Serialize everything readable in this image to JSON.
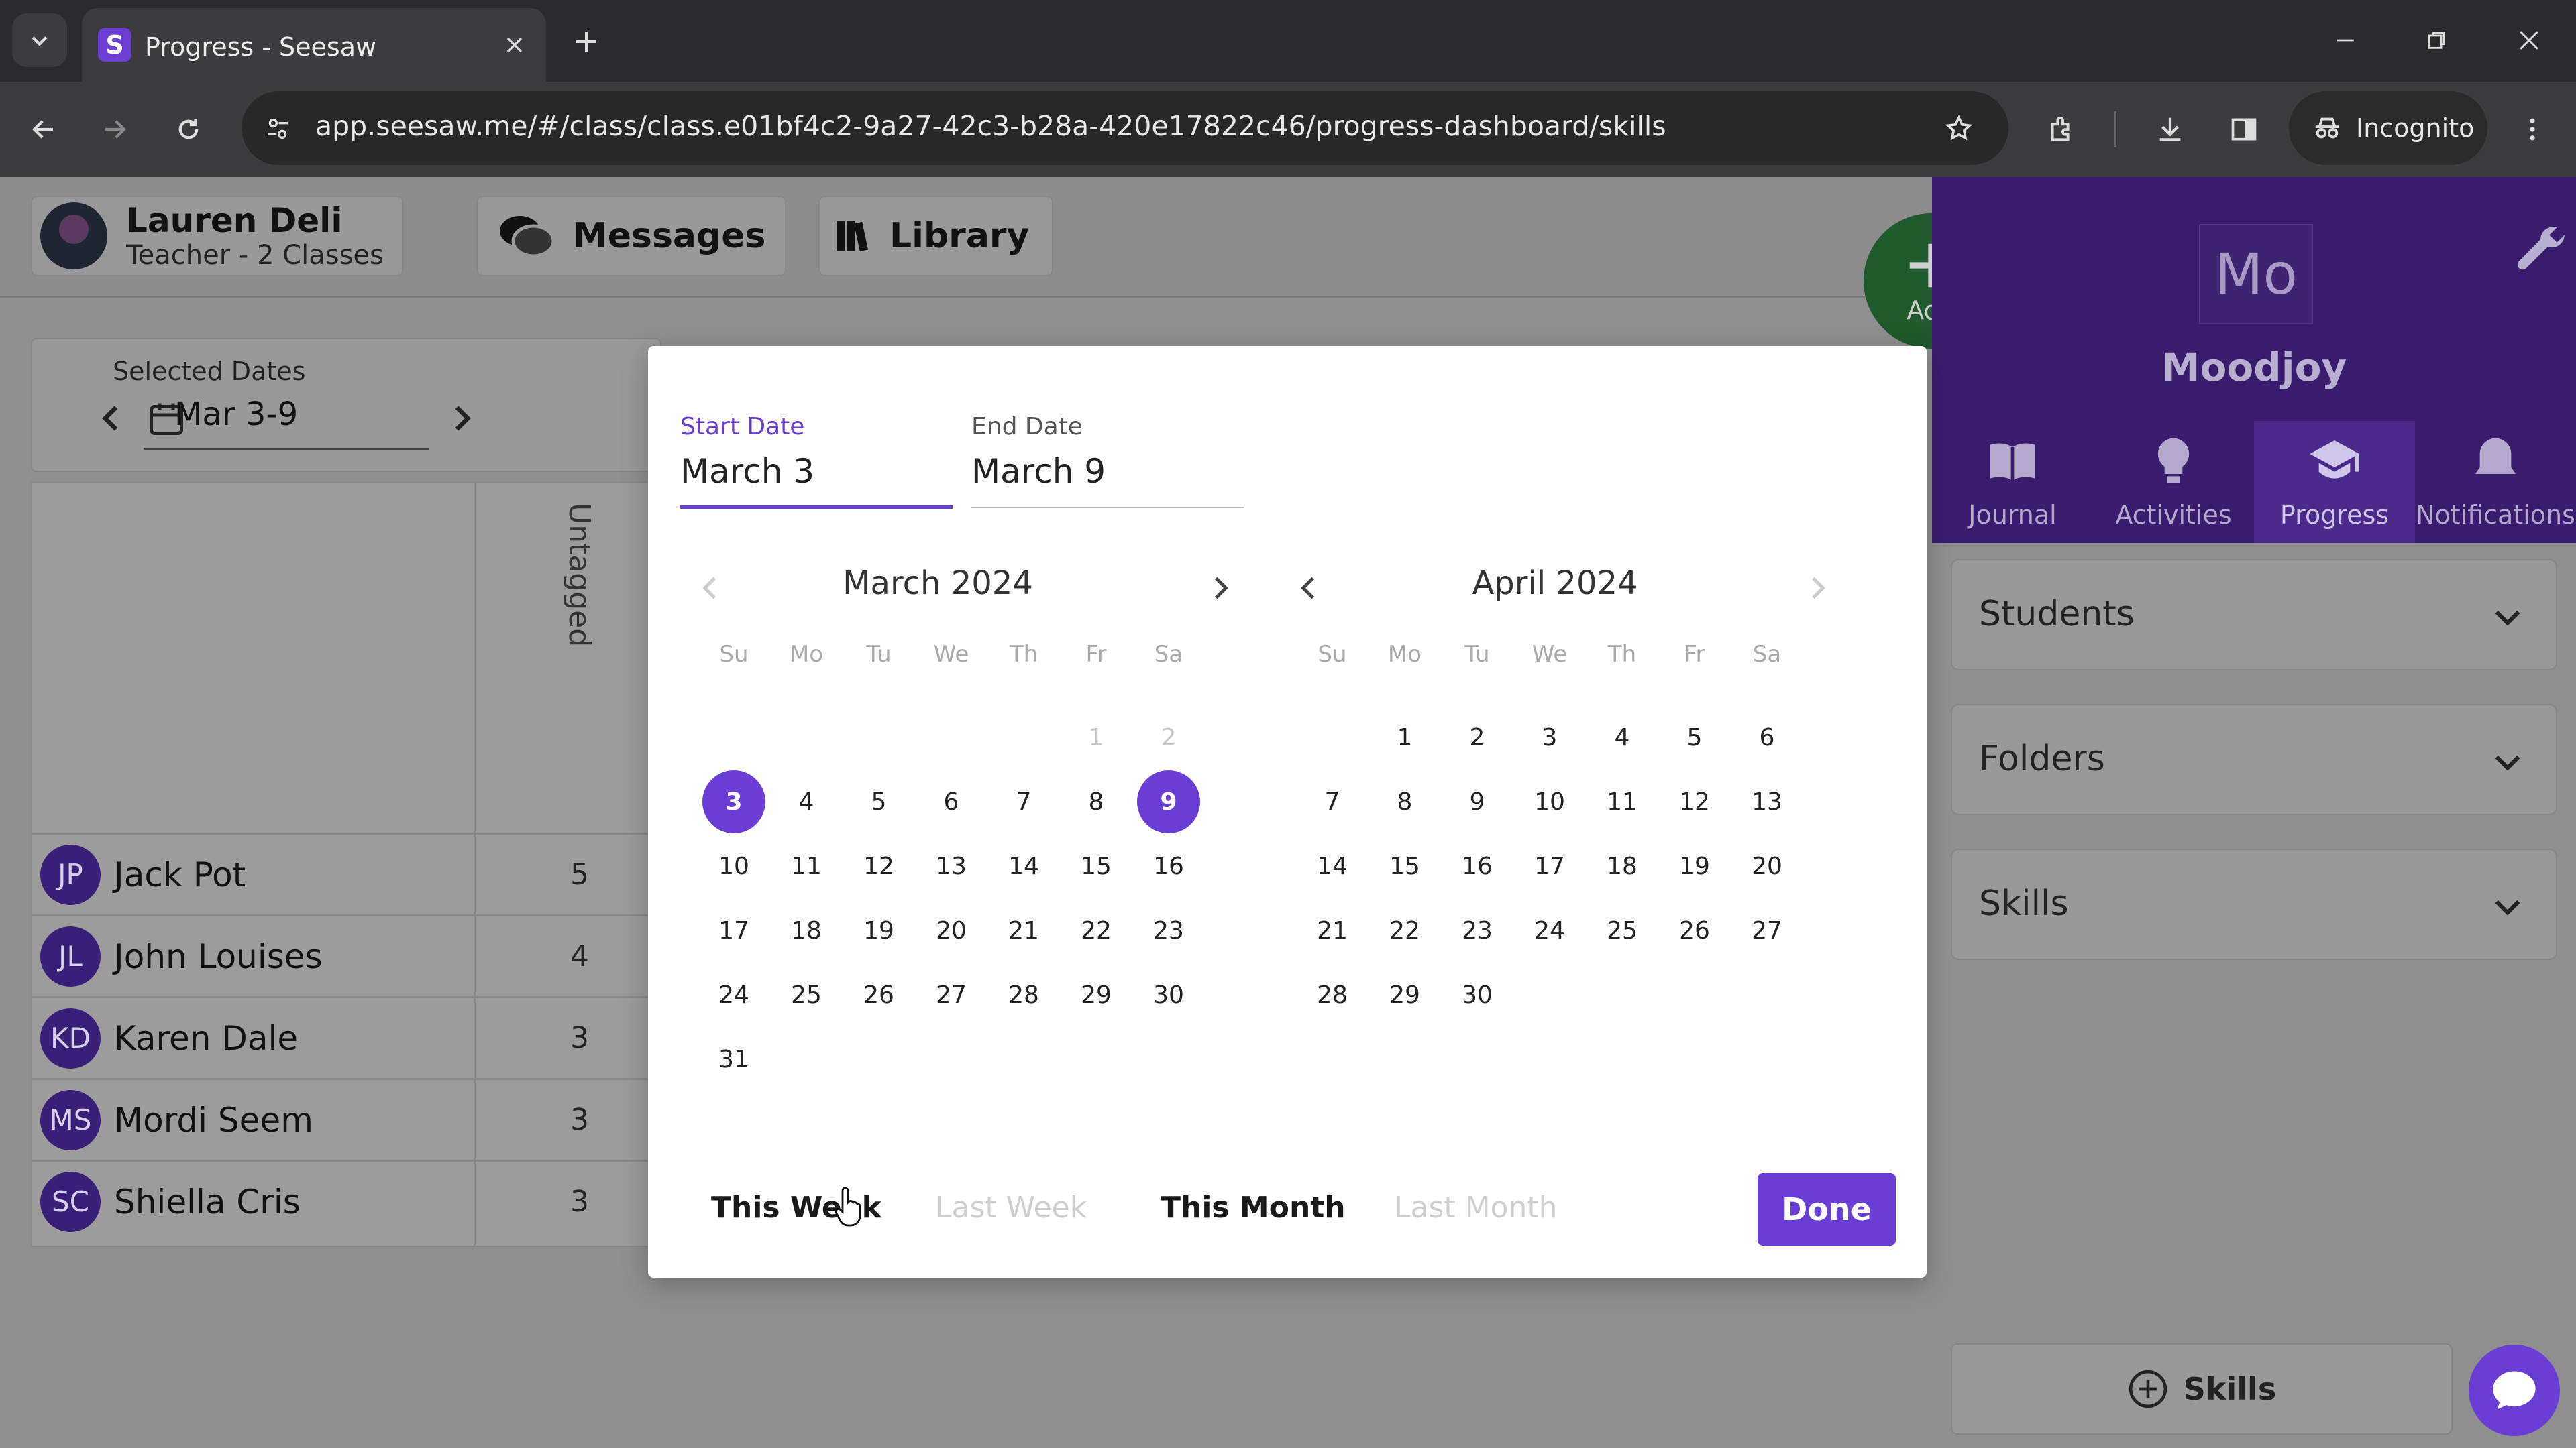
{
  "browser": {
    "tab_title": "Progress - Seesaw",
    "favicon_letter": "S",
    "url": "app.seesaw.me/#/class/class.e01bf4c2-9a27-42c3-b28a-420e17822c46/progress-dashboard/skills",
    "incognito_label": "Incognito"
  },
  "header": {
    "user_name": "Lauren Deli",
    "user_role": "Teacher - 2 Classes",
    "messages_label": "Messages",
    "library_label": "Library",
    "add_label": "Add"
  },
  "date_range": {
    "label": "Selected Dates",
    "value": "Mar 3-9"
  },
  "table": {
    "column_header": "Untagged",
    "rows": [
      {
        "initials": "JP",
        "name": "Jack Pot",
        "count": "5"
      },
      {
        "initials": "JL",
        "name": "John Louises",
        "count": "4"
      },
      {
        "initials": "KD",
        "name": "Karen Dale",
        "count": "3"
      },
      {
        "initials": "MS",
        "name": "Mordi Seem",
        "count": "3"
      },
      {
        "initials": "SC",
        "name": "Shiella Cris",
        "count": "3"
      }
    ]
  },
  "right_panel": {
    "class_initials": "Mo",
    "class_name": "Moodjoy",
    "tabs": [
      {
        "label": "Journal",
        "icon": "book-icon"
      },
      {
        "label": "Activities",
        "icon": "lightbulb-icon"
      },
      {
        "label": "Progress",
        "icon": "graduation-cap-icon",
        "active": true
      },
      {
        "label": "Notifications",
        "icon": "bell-icon"
      }
    ],
    "filters": [
      "Students",
      "Folders",
      "Skills"
    ],
    "skills_button": "Skills"
  },
  "date_picker": {
    "start_label": "Start Date",
    "start_value": "March 3",
    "end_label": "End Date",
    "end_value": "March 9",
    "weekdays": [
      "Su",
      "Mo",
      "Tu",
      "We",
      "Th",
      "Fr",
      "Sa"
    ],
    "months": [
      {
        "title": "March 2024",
        "leading": [],
        "muted": [
          "1",
          "2"
        ],
        "lead_blank": 5,
        "days": 31,
        "selected": [
          3,
          9
        ]
      },
      {
        "title": "April 2024",
        "lead_blank": 1,
        "days": 30,
        "selected": []
      }
    ],
    "presets": [
      {
        "label": "This Week",
        "enabled": true
      },
      {
        "label": "Last Week",
        "enabled": false
      },
      {
        "label": "This Month",
        "enabled": true
      },
      {
        "label": "Last Month",
        "enabled": false
      }
    ],
    "done_label": "Done"
  },
  "colors": {
    "accent": "#6a3ed4",
    "panel_purple": "#3a1c6e"
  }
}
